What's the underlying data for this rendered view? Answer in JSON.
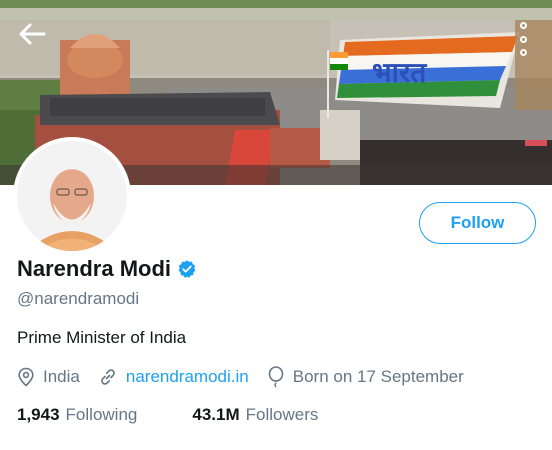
{
  "profile": {
    "name": "Narendra Modi",
    "handle": "@narendramodi",
    "bio": "Prime Minister of India",
    "location": "India",
    "website": "narendramodi.in",
    "birthday": "Born on 17 September",
    "verified": true
  },
  "actions": {
    "follow_label": "Follow"
  },
  "stats": {
    "following_count": "1,943",
    "following_label": "Following",
    "followers_count": "43.1M",
    "followers_label": "Followers"
  },
  "banner": {
    "flag_text": "भारत"
  },
  "icons": {
    "back": "arrow-left-icon",
    "more": "more-vertical-icon",
    "verified": "verified-badge-icon",
    "location": "location-pin-icon",
    "link": "link-icon",
    "birthday": "balloon-icon"
  },
  "colors": {
    "accent": "#1da1f2",
    "secondary_text": "#657786",
    "primary_text": "#14171a"
  }
}
